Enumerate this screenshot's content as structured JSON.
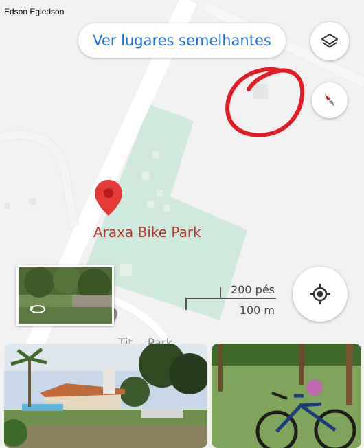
{
  "author": "Edson Egledson",
  "search_similar": {
    "label": "Ver lugares semelhantes"
  },
  "map": {
    "place_name": "Araxa Bike Park",
    "partial_label": "Tit... Park",
    "scale": {
      "feet": "200 pés",
      "meters": "100 m"
    }
  },
  "icons": {
    "layers": "layers-icon",
    "compass": "compass-icon",
    "locate": "my-location-icon",
    "pin": "map-pin-icon",
    "street_view": "street-view-rotate-icon"
  },
  "colors": {
    "accent_blue": "#1a73e8",
    "pin_red": "#e53935",
    "park_green": "#cfe9dc",
    "annotation_red": "#e31b23"
  }
}
